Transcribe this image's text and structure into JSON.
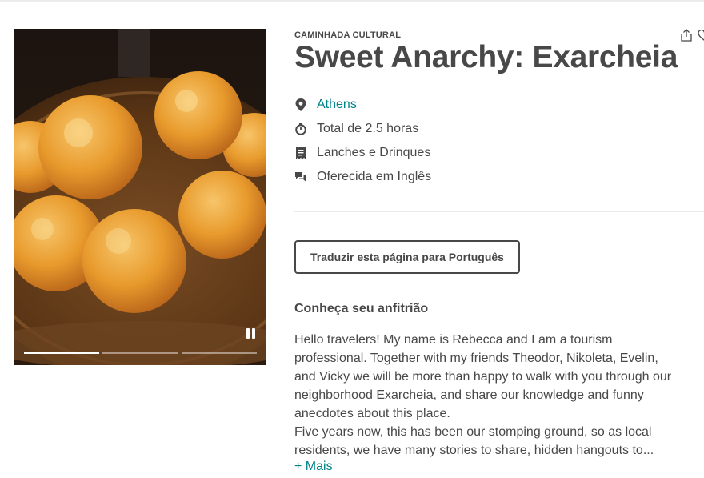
{
  "hero": {
    "image_alt": "Greek honey puffs (loukoumades) dusted with cinnamon",
    "controls": {
      "pause_icon": "pause-icon"
    },
    "progress": {
      "segments": 3,
      "active_segment": 1
    }
  },
  "experience": {
    "category": "CAMINHADA CULTURAL",
    "title": "Sweet Anarchy: Exarcheia",
    "facts": [
      {
        "icon": "location-pin-icon",
        "text": "Athens",
        "is_link": true
      },
      {
        "icon": "clock-icon",
        "text": "Total de 2.5 horas",
        "is_link": false
      },
      {
        "icon": "receipt-icon",
        "text": "Lanches e Drinques",
        "is_link": false
      },
      {
        "icon": "chat-bubbles-icon",
        "text": "Oferecida em Inglês",
        "is_link": false
      }
    ],
    "actions": {
      "share_icon": "share-icon",
      "save_icon": "heart-icon"
    }
  },
  "translate_button": {
    "label": "Traduzir esta página para Português"
  },
  "host": {
    "heading": "Conheça seu anfitrião",
    "bio_p1": "Hello travelers! My name is Rebecca and I am a tourism professional. Together with my friends Theodor, Nikoleta, Evelin, and Vicky we will be more than happy to walk with you through our neighborhood Exarcheia, and share our knowledge and funny anecdotes about this place.",
    "bio_p2": "Five years now, this has been our stomping ground, so as local residents, we have many stories to share, hidden hangouts to...",
    "more_label": "+ Mais"
  },
  "colors": {
    "text": "#484848",
    "link": "#008489",
    "border": "#484848",
    "divider": "#ebebeb"
  }
}
